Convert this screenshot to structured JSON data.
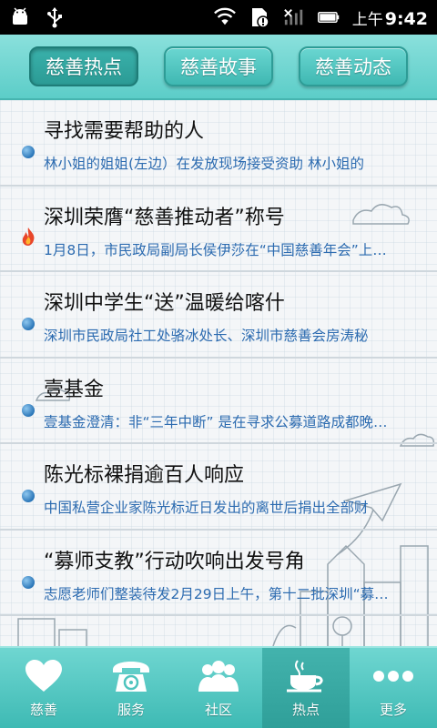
{
  "status_bar": {
    "ampm": "上午",
    "time": "9:42"
  },
  "tabs": [
    {
      "label": "慈善热点",
      "active": true
    },
    {
      "label": "慈善故事",
      "active": false
    },
    {
      "label": "慈善动态",
      "active": false
    }
  ],
  "news": [
    {
      "title": "寻找需要帮助的人",
      "desc": "林小姐的姐姐(左边）在发放现场接受资助 林小姐的",
      "bullet": "blue-dot"
    },
    {
      "title": "深圳荣膺“慈善推动者”称号",
      "desc": "1月8日，市民政局副局长侯伊莎在“中国慈善年会”上…",
      "bullet": "fire"
    },
    {
      "title": "深圳中学生“送”温暖给喀什",
      "desc": "深圳市民政局社工处骆冰处长、深圳市慈善会房涛秘",
      "bullet": "blue-dot"
    },
    {
      "title": "壹基金",
      "desc": "壹基金澄清：非“三年中断” 是在寻求公募道路成都晚…",
      "bullet": "blue-dot"
    },
    {
      "title": "陈光标裸捐逾百人响应",
      "desc": "中国私营企业家陈光标近日发出的离世后捐出全部财",
      "bullet": "blue-dot"
    },
    {
      "title": "“募师支教”行动吹响出发号角",
      "desc": "志愿老师们整装待发2月29日上午，第十二批深圳“募…",
      "bullet": "blue-dot"
    }
  ],
  "bottom_nav": [
    {
      "label": "慈善",
      "icon": "heart-icon",
      "active": false
    },
    {
      "label": "服务",
      "icon": "telephone-icon",
      "active": false
    },
    {
      "label": "社区",
      "icon": "people-icon",
      "active": false
    },
    {
      "label": "热点",
      "icon": "coffee-cup-icon",
      "active": true
    },
    {
      "label": "更多",
      "icon": "more-dots-icon",
      "active": false
    }
  ],
  "colors": {
    "accent": "#4fc4be",
    "desc_text": "#2c6bb0",
    "title_text": "#111111"
  }
}
